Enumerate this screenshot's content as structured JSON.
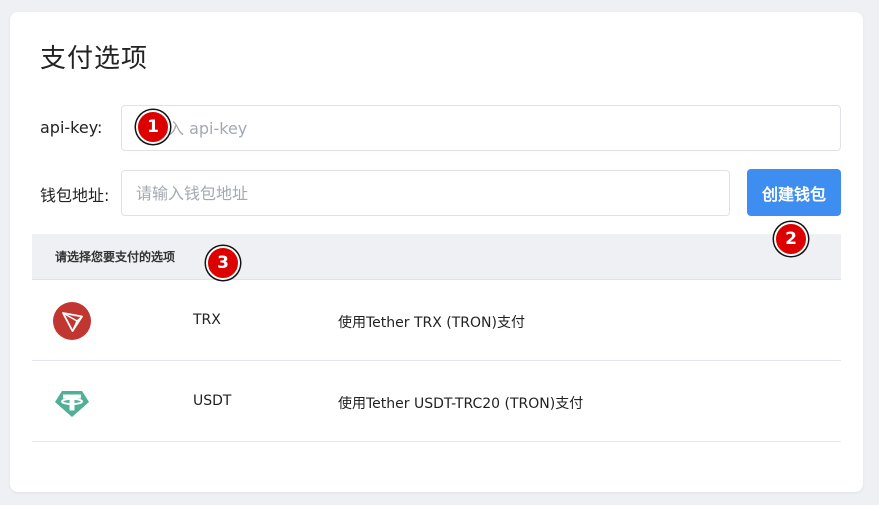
{
  "page": {
    "title": "支付选项"
  },
  "form": {
    "api_key_label": "api-key:",
    "api_key_placeholder": "请输入 api-key",
    "wallet_label": "钱包地址:",
    "wallet_placeholder": "请输入钱包地址",
    "create_wallet_button": "创建钱包"
  },
  "options_table": {
    "header": "请选择您要支付的选项",
    "rows": [
      {
        "icon": "tron-icon",
        "name": "TRX",
        "description": "使用Tether TRX (TRON)支付"
      },
      {
        "icon": "tether-icon",
        "name": "USDT",
        "description": "使用Tether USDT-TRC20 (TRON)支付"
      }
    ]
  },
  "annotations": [
    "1",
    "2",
    "3"
  ],
  "colors": {
    "accent": "#3d8ef0",
    "background": "#eef0f3",
    "tron": "#c23631",
    "tether": "#50af95",
    "badge": "#dd0000"
  }
}
